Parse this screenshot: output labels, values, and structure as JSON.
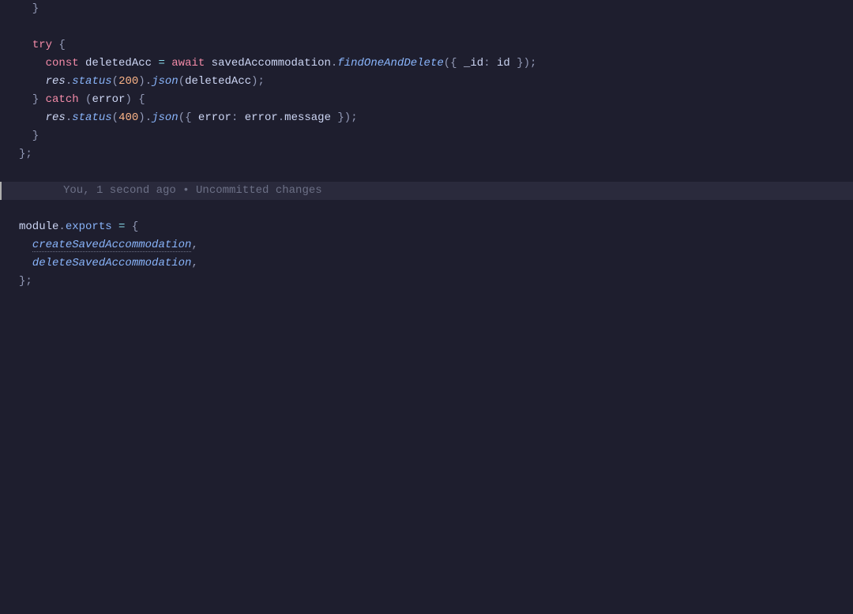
{
  "code": {
    "l1": "  }",
    "l3_try": "try",
    "l3_brace": " {",
    "l4_const": "const",
    "l4_var": " deletedAcc ",
    "l4_eq": "=",
    "l4_await": " await",
    "l4_obj": " savedAccommodation",
    "l4_dot1": ".",
    "l4_fn": "findOneAndDelete",
    "l4_p1": "({ ",
    "l4_idkey": "_id",
    "l4_colon": ":",
    "l4_idval": " id ",
    "l4_p2": "});",
    "l5_res": "res",
    "l5_dot1": ".",
    "l5_status": "status",
    "l5_p1": "(",
    "l5_200": "200",
    "l5_p2": ")",
    "l5_dot2": ".",
    "l5_json": "json",
    "l5_p3": "(",
    "l5_arg": "deletedAcc",
    "l5_p4": ");",
    "l6_brace1": "} ",
    "l6_catch": "catch",
    "l6_p1": " (",
    "l6_err": "error",
    "l6_p2": ") {",
    "l7_res": "res",
    "l7_dot1": ".",
    "l7_status": "status",
    "l7_p1": "(",
    "l7_400": "400",
    "l7_p2": ")",
    "l7_dot2": ".",
    "l7_json": "json",
    "l7_p3": "({ ",
    "l7_errkey": "error",
    "l7_colon": ":",
    "l7_errval": " error",
    "l7_dot3": ".",
    "l7_msg": "message ",
    "l7_p4": "});",
    "l8": "  }",
    "l9": "};",
    "l12_module": "module",
    "l12_dot": ".",
    "l12_exports": "exports ",
    "l12_eq": "=",
    "l12_brace": " {",
    "l13_create": "createSavedAccommodation",
    "l13_comma": ",",
    "l14_delete": "deleteSavedAccommodation",
    "l14_comma": ",",
    "l15": "};"
  },
  "gitlens": {
    "text": "You, 1 second ago • Uncommitted changes"
  }
}
